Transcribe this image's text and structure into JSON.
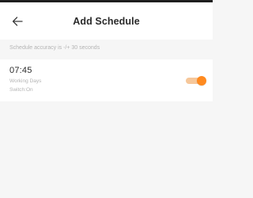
{
  "header": {
    "back_icon": "back-arrow-icon",
    "title": "Add Schedule"
  },
  "info": {
    "accuracy_note": "Schedule accuracy is -/+ 30 seconds"
  },
  "schedules": [
    {
      "time": "07:45",
      "repeat": "Working Days",
      "action": "Switch:On",
      "enabled": true
    }
  ],
  "colors": {
    "accent": "#ff8a1f",
    "toggle_track_on": "#f6c79a",
    "background": "#f6f6f6",
    "card": "#ffffff",
    "primary_text": "#2a2a2a",
    "secondary_text": "#b4b4b4"
  }
}
